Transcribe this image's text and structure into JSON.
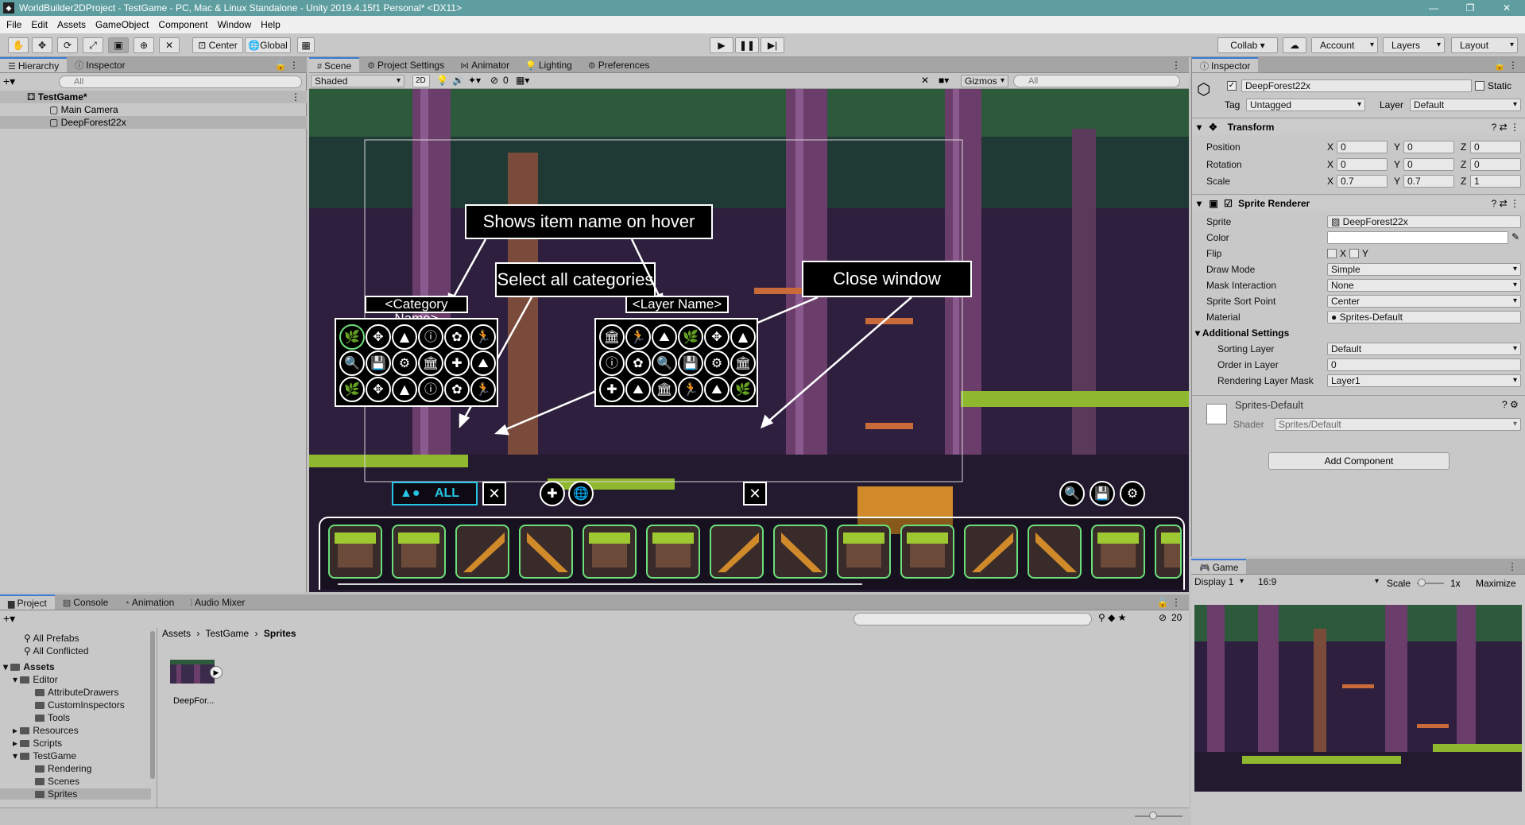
{
  "window": {
    "title": "WorldBuilder2DProject - TestGame - PC, Mac & Linux Standalone - Unity 2019.4.15f1 Personal* <DX11>",
    "controls": [
      "—",
      "❐",
      "✕"
    ]
  },
  "menu": [
    "File",
    "Edit",
    "Assets",
    "GameObject",
    "Component",
    "Window",
    "Help"
  ],
  "toolbar": {
    "pivot": "Center",
    "space": "Global",
    "collab": "Collab ▾",
    "account": "Account",
    "layers": "Layers",
    "layout": "Layout"
  },
  "hierarchy": {
    "tabs": [
      "Hierarchy",
      "Inspector"
    ],
    "search_placeholder": "All",
    "scene": "TestGame*",
    "items": [
      "Main Camera",
      "DeepForest22x"
    ]
  },
  "scene": {
    "tabs": [
      "Scene",
      "Project Settings",
      "Animator",
      "Lighting",
      "Preferences"
    ],
    "shading": "Shaded",
    "mode_2d": "2D",
    "hidden_count": "0",
    "gizmos": "Gizmos",
    "search_placeholder": "All",
    "callouts": {
      "hover": "Shows item name on hover",
      "select_all": "Select all categories",
      "close": "Close window"
    },
    "category_label": "<Category Name>",
    "layer_label": "<Layer Name>",
    "all_button": "ALL",
    "close_glyph": "✕",
    "category_icons": [
      "🌿",
      "✥",
      "▲",
      "ⓘ",
      "✿",
      "🏃",
      "🔍",
      "💾",
      "⚙",
      "🏛",
      "✚",
      "⛰",
      "🌿",
      "✥",
      "▲",
      "ⓘ",
      "✿",
      "🏃"
    ],
    "layer_icons": [
      "🏛",
      "🏃",
      "⛰",
      "🌿",
      "✥",
      "▲",
      "ⓘ",
      "✿",
      "🔍",
      "💾",
      "⚙",
      "🏛",
      "✚",
      "⛰",
      "🏛",
      "🏃",
      "⛰",
      "🌿"
    ],
    "tool_icons_left": [
      "✚",
      "🌐"
    ],
    "tool_icons_right": [
      "🔍",
      "💾",
      "⚙"
    ]
  },
  "inspector": {
    "tab": "Inspector",
    "object_name": "DeepForest22x",
    "static_label": "Static",
    "tag_label": "Tag",
    "tag": "Untagged",
    "layer_label": "Layer",
    "layer": "Default",
    "transform": {
      "header": "Transform",
      "position_label": "Position",
      "rotation_label": "Rotation",
      "scale_label": "Scale",
      "position": [
        "0",
        "0",
        "0"
      ],
      "rotation": [
        "0",
        "0",
        "0"
      ],
      "scale": [
        "0.7",
        "0.7",
        "1"
      ]
    },
    "sprite_renderer": {
      "header": "Sprite Renderer",
      "labels": [
        "Sprite",
        "Color",
        "Flip",
        "Draw Mode",
        "Mask Interaction",
        "Sprite Sort Point",
        "Material"
      ],
      "sprite": "DeepForest22x",
      "flip_x": "X",
      "flip_y": "Y",
      "draw_mode": "Simple",
      "mask_interaction": "None",
      "sort_point": "Center",
      "material": "Sprites-Default",
      "additional_header": "Additional Settings",
      "sorting_layer_label": "Sorting Layer",
      "sorting_layer": "Default",
      "order_label": "Order in Layer",
      "order": "0",
      "rendering_mask_label": "Rendering Layer Mask",
      "rendering_mask": "Layer1"
    },
    "material_name": "Sprites-Default",
    "shader_label": "Shader",
    "shader": "Sprites/Default",
    "add_component": "Add Component"
  },
  "game": {
    "tab": "Game",
    "display": "Display 1",
    "aspect": "16:9",
    "scale_label": "Scale",
    "scale_value": "1x",
    "maximize": "Maximize"
  },
  "project": {
    "tabs": [
      "Project",
      "Console",
      "Animation",
      "Audio Mixer"
    ],
    "hidden_count": "20",
    "favorites": [
      "All Prefabs",
      "All Conflicted"
    ],
    "tree": [
      "Assets",
      "Editor",
      "AttributeDrawers",
      "CustomInspectors",
      "Tools",
      "Resources",
      "Scripts",
      "TestGame",
      "Rendering",
      "Scenes",
      "Sprites"
    ],
    "breadcrumb": [
      "Assets",
      "TestGame",
      "Sprites"
    ],
    "asset": "DeepFor..."
  },
  "colors": {
    "title_bar": "#5f9ea0",
    "panel_bg": "#c8c8c8",
    "selection": "#3a7bd5",
    "tile_border": "#6be07a",
    "all_button": "#28c6e6"
  }
}
